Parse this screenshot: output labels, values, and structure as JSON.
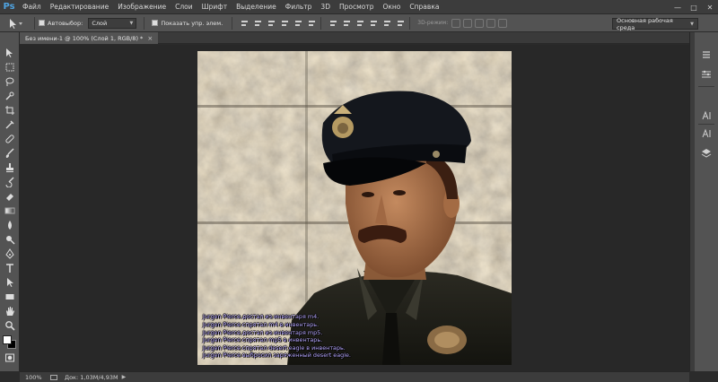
{
  "app": {
    "logo": "Ps"
  },
  "menu": [
    "Файл",
    "Редактирование",
    "Изображение",
    "Слои",
    "Шрифт",
    "Выделение",
    "Фильтр",
    "3D",
    "Просмотр",
    "Окно",
    "Справка"
  ],
  "window_controls": {
    "minimize": "—",
    "maximize": "□",
    "close": "✕"
  },
  "options_bar": {
    "autoselect_label": "Автовыбор:",
    "autoselect_value": "Слой",
    "show_transform_label": "Показать упр. элем.",
    "mode_3d_label": "3D-режим:",
    "workspace_value": "Основная рабочая среда"
  },
  "document_tab": {
    "title": "Без имени-1 @ 100% (Слой 1, RGB/8) *",
    "close": "×"
  },
  "chat_lines": [
    "Jurgen Pierce достал из инвентаря m4.",
    "Jurgen Pierce спрятал m4 в инвентарь.",
    "Jurgen Pierce достал из инвентаря mp5.",
    "Jurgen Pierce спрятал mp5 в инвентарь.",
    "Jurgen Pierce спрятал desert eagle в инвентарь.",
    "Jurgen Pierce выбросил заряженный desert eagle."
  ],
  "status_bar": {
    "zoom": "100%",
    "doc_info": "Док: 1,03M/4,93M",
    "arrow": "▶"
  },
  "colors": {
    "chrome": "#535353",
    "background": "#282828",
    "chat": "#b7a8ff",
    "accent": "#4fa3e0"
  }
}
